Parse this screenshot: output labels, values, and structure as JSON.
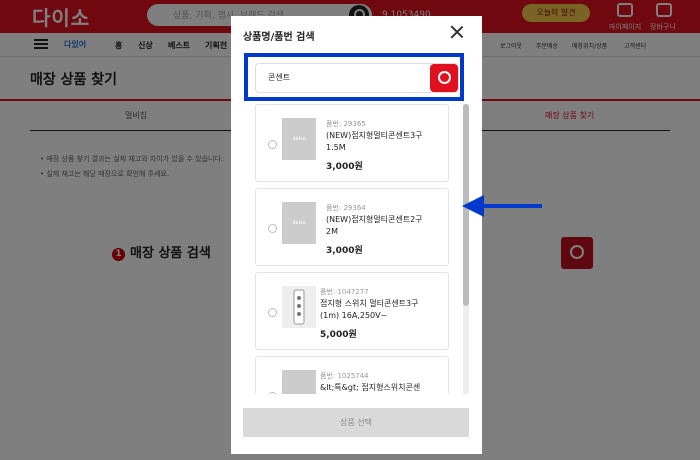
{
  "header": {
    "logo": "다이소",
    "search_placeholder": "상품, 기획, 행사, 브랜드 검색",
    "store": "9 1053490",
    "promo": "오늘의 발견",
    "my_label": "마이페이지",
    "cart_label": "장바구니"
  },
  "nav": {
    "logo": "다있어",
    "items": [
      "홍",
      "신상",
      "베스트",
      "기획전"
    ],
    "right_items": [
      "로그아웃",
      "주문배송",
      "매장위치/상품",
      "고객센터"
    ]
  },
  "page": {
    "title": "매장 상품 찾기",
    "tab_left": "멀비칩",
    "tab_right": "매장 상품 찾기",
    "notes": [
      "• 매장 상품 찾기 결과는 실제 재고와 차이가 있을 수 있습니다.",
      "• 실제 재고는 해당 매장으로 확인해 주세요."
    ],
    "section_num": "1",
    "section_title": "매장 상품 검색"
  },
  "modal": {
    "title": "상품명/품번 검색",
    "search_value": "콘센트",
    "select_button": "상품 선택",
    "products": [
      {
        "sku": "품번: 29365",
        "name1": "(NEW)접지형멀티콘센트3구",
        "name2": "1.5M",
        "price": "3,000원",
        "thumb": "daiso"
      },
      {
        "sku": "품번: 29364",
        "name1": "(NEW)접지형멀티콘센트2구",
        "name2": "2M",
        "price": "3,000원",
        "thumb": "daiso"
      },
      {
        "sku": "품번: 1047277",
        "name1": "접지형 스위치 멀티콘센트3구",
        "name2": "(1m) 16A,250V~",
        "price": "5,000원",
        "thumb": ""
      },
      {
        "sku": "품번: 1025744",
        "name1": "&lt;특&gt; 접지형스위치콘센",
        "name2": "",
        "price": "",
        "thumb": ""
      }
    ]
  },
  "colors": {
    "brand": "#e0101f",
    "highlight": "#0039cc"
  }
}
